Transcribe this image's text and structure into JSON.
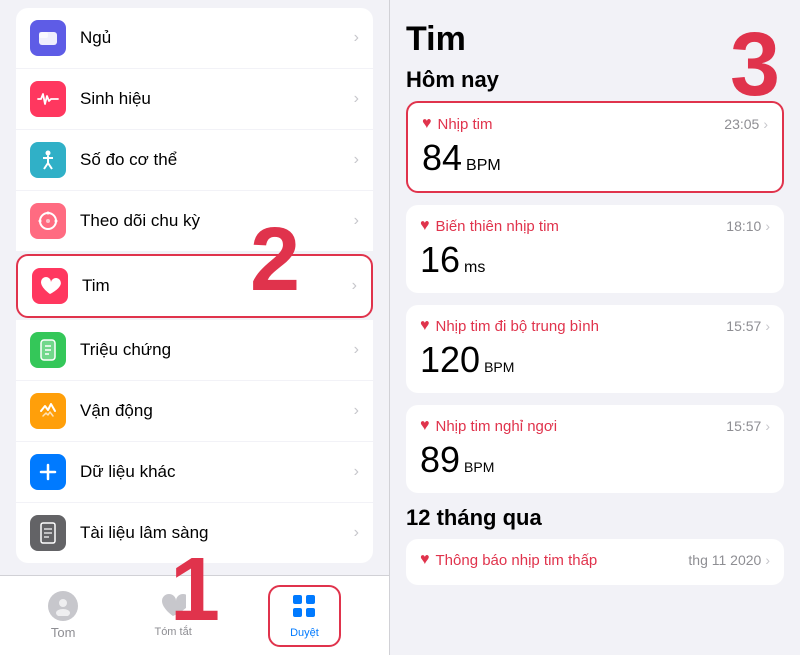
{
  "left": {
    "menuGroups": [
      {
        "id": "group1",
        "items": [
          {
            "id": "ngu",
            "label": "Ngủ",
            "iconType": "sleep",
            "selected": false
          },
          {
            "id": "sinh-hieu",
            "label": "Sinh hiệu",
            "iconType": "vitals",
            "selected": false
          },
          {
            "id": "so-do",
            "label": "Số đo cơ thể",
            "iconType": "body",
            "selected": false
          },
          {
            "id": "theo-doi",
            "label": "Theo dõi chu kỳ",
            "iconType": "cycle",
            "selected": false
          },
          {
            "id": "tim",
            "label": "Tim",
            "iconType": "heart",
            "selected": true
          },
          {
            "id": "trieu-chung",
            "label": "Triệu chứng",
            "iconType": "symptoms",
            "selected": false
          },
          {
            "id": "van-dong",
            "label": "Vận động",
            "iconType": "activity",
            "selected": false
          },
          {
            "id": "du-lieu",
            "label": "Dữ liệu khác",
            "iconType": "other",
            "selected": false
          },
          {
            "id": "tai-lieu",
            "label": "Tài liệu lâm sàng",
            "iconType": "docs",
            "selected": false
          }
        ]
      }
    ],
    "tabBar": {
      "tomLabel": "Tom",
      "tomtatLabel": "Tóm tắt",
      "duyetLabel": "Duyệt"
    }
  },
  "right": {
    "title": "Tim",
    "sectionToday": "Hôm nay",
    "section12months": "12 tháng qua",
    "cards": [
      {
        "id": "nhip-tim",
        "title": "Nhịp tim",
        "time": "23:05",
        "value": "84",
        "unit": "BPM",
        "highlighted": true
      },
      {
        "id": "bien-thien",
        "title": "Biến thiên nhịp tim",
        "time": "18:10",
        "value": "16",
        "unit": "ms",
        "highlighted": false
      },
      {
        "id": "nhip-tim-di-bo",
        "title": "Nhịp tim đi bộ trung bình",
        "time": "15:57",
        "value": "120",
        "unit": "BPM",
        "highlighted": false
      },
      {
        "id": "nhip-tim-nghi",
        "title": "Nhịp tim nghỉ ngơi",
        "time": "15:57",
        "value": "89",
        "unit": "BPM",
        "highlighted": false
      }
    ],
    "cardBottom": {
      "id": "thong-bao",
      "title": "Thông báo nhịp tim thấp",
      "time": "thg 11 2020"
    }
  },
  "numbers": {
    "n1": "1",
    "n2": "2",
    "n3": "3"
  }
}
